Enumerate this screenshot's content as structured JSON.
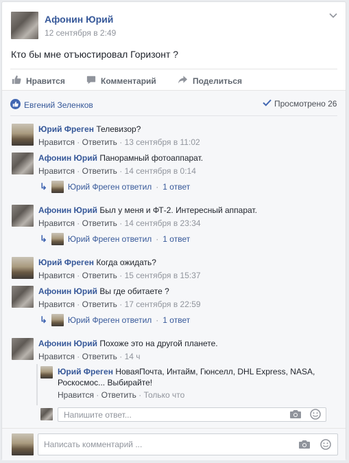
{
  "post": {
    "author": "Афонин Юрий",
    "date": "12 сентября в 2:49",
    "text": "Кто бы мне отъюстировал Горизонт ?",
    "actions": {
      "like": "Нравится",
      "comment": "Комментарий",
      "share": "Поделиться"
    },
    "liker": "Евгений Зеленков",
    "seen": "Просмотрено 26"
  },
  "comments": [
    {
      "author": "Юрий Фреген",
      "text": "Телевизор?",
      "like": "Нравится",
      "reply": "Ответить",
      "time": "13 сентября в 11:02"
    },
    {
      "author": "Афонин Юрий",
      "text": "Панорамный фотоаппарат.",
      "like": "Нравится",
      "reply": "Ответить",
      "time": "14 сентября в 0:14",
      "replies": {
        "text": "Юрий Фреген ответил",
        "count": "1 ответ"
      }
    },
    {
      "author": "Афонин Юрий",
      "text": "Был у меня и ФТ-2. Интересный аппарат.",
      "like": "Нравится",
      "reply": "Ответить",
      "time": "14 сентября в 23:34",
      "replies": {
        "text": "Юрий Фреген ответил",
        "count": "1 ответ"
      }
    },
    {
      "author": "Юрий Фреген",
      "text": "Когда ожидать?",
      "like": "Нравится",
      "reply": "Ответить",
      "time": "15 сентября в 15:37"
    },
    {
      "author": "Афонин Юрий",
      "text": "Вы где обитаете ?",
      "like": "Нравится",
      "reply": "Ответить",
      "time": "17 сентября в 22:59",
      "replies": {
        "text": "Юрий Фреген ответил",
        "count": "1 ответ"
      }
    },
    {
      "author": "Афонин Юрий",
      "text": "Похоже это на другой планете.",
      "like": "Нравится",
      "reply": "Ответить",
      "time": "14 ч"
    }
  ],
  "nested_reply": {
    "author": "Юрий Фреген",
    "text_line1": "НоваяПочта, Интайм, Гюнселл, DHL Express, NASA,",
    "text_line2": "Роскосмос... Выбирайте!",
    "like": "Нравится",
    "reply": "Ответить",
    "time": "Только что"
  },
  "reply_input": {
    "placeholder": "Напишите ответ..."
  },
  "comment_input": {
    "placeholder": "Написать комментарий ..."
  },
  "sep": " · "
}
